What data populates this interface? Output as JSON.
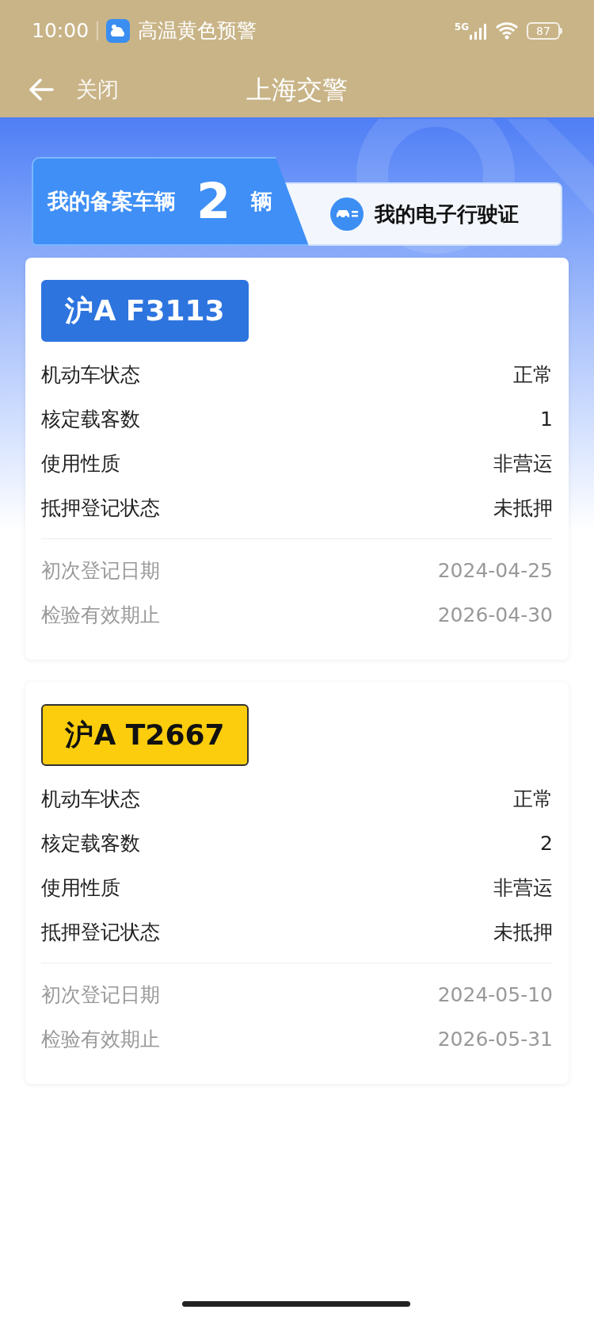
{
  "status_bar": {
    "time": "10:00",
    "notification": "高温黄色预警",
    "network": "5G",
    "battery": "87"
  },
  "header": {
    "close": "关闭",
    "title": "上海交警"
  },
  "tabs": [
    {
      "label": "我的备案车辆",
      "count": "2",
      "unit": "辆",
      "selected": true
    },
    {
      "label": "我的电子行驶证",
      "selected": false
    }
  ],
  "vehicles": [
    {
      "plate": "沪A F3113",
      "kind": "blue",
      "details": [
        {
          "label": "机动车状态",
          "value": "正常"
        },
        {
          "label": "核定载客数",
          "value": "1"
        },
        {
          "label": "使用性质",
          "value": "非营运"
        },
        {
          "label": "抵押登记状态",
          "value": "未抵押"
        }
      ],
      "dates": [
        {
          "label": "初次登记日期",
          "value": "2024-04-25"
        },
        {
          "label": "检验有效期止",
          "value": "2026-04-30"
        }
      ]
    },
    {
      "plate": "沪A T2667",
      "kind": "yellow",
      "details": [
        {
          "label": "机动车状态",
          "value": "正常"
        },
        {
          "label": "核定载客数",
          "value": "2"
        },
        {
          "label": "使用性质",
          "value": "非营运"
        },
        {
          "label": "抵押登记状态",
          "value": "未抵押"
        }
      ],
      "dates": [
        {
          "label": "初次登记日期",
          "value": "2024-05-10"
        },
        {
          "label": "检验有效期止",
          "value": "2026-05-31"
        }
      ]
    }
  ]
}
